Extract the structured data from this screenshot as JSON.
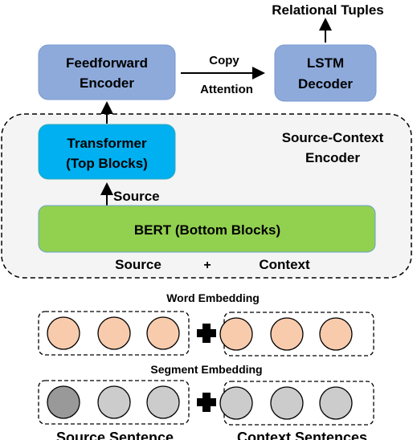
{
  "output_label": "Relational Tuples",
  "feedforward": {
    "line1": "Feedforward",
    "line2": "Encoder"
  },
  "lstm": {
    "line1": "LSTM",
    "line2": "Decoder"
  },
  "copy_label": {
    "line1": "Copy",
    "line2": "Attention"
  },
  "encoder_group": {
    "line1": "Source-Context",
    "line2": "Encoder"
  },
  "transformer": {
    "line1": "Transformer",
    "line2": "(Top Blocks)"
  },
  "source_arrow_label": "Source",
  "bert": "BERT (Bottom Blocks)",
  "inputs": {
    "source": "Source",
    "plus": "+",
    "context": "Context"
  },
  "word_embedding": "Word Embedding",
  "segment_embedding": "Segment Embedding",
  "bottom": {
    "source": "Source Sentence",
    "context": "Context Sentences"
  },
  "colors": {
    "encoder_blue": "#8eaadb",
    "transformer": "#00b0f0",
    "bert": "#92d050",
    "word": "#f8cbad",
    "segment": "#cccccc",
    "segment_source": "#999999",
    "group_bg": "#f4f4f4"
  }
}
